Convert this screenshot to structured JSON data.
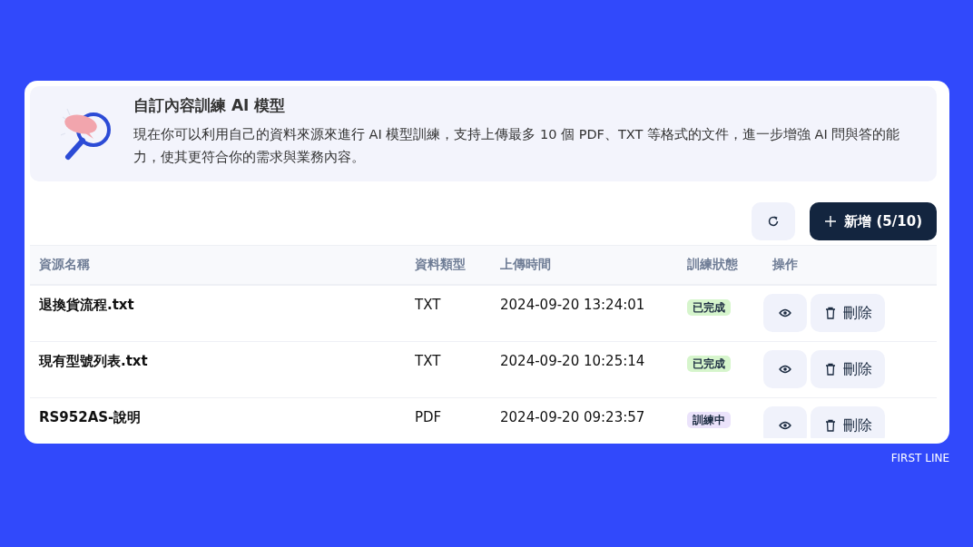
{
  "banner": {
    "title": "自訂內容訓練 AI 模型",
    "description": "現在你可以利用自己的資料來源來進行 AI 模型訓練，支持上傳最多 10 個 PDF、TXT 等格式的文件，進一步增強 AI 問與答的能力，使其更符合你的需求與業務內容。"
  },
  "toolbar": {
    "add_button": "新增 (5/10)"
  },
  "table": {
    "columns": [
      "資源名稱",
      "資料類型",
      "上傳時間",
      "訓練狀態",
      "操作"
    ],
    "rows": [
      {
        "name": "退換貨流程.txt",
        "type": "TXT",
        "uploaded": "2024-09-20 13:24:01",
        "status": {
          "label": "已完成",
          "kind": "done"
        },
        "delete": "刪除"
      },
      {
        "name": "現有型號列表.txt",
        "type": "TXT",
        "uploaded": "2024-09-20 10:25:14",
        "status": {
          "label": "已完成",
          "kind": "done"
        },
        "delete": "刪除"
      },
      {
        "name": "RS952AS-說明",
        "type": "PDF",
        "uploaded": "2024-09-20 09:23:57",
        "status": {
          "label": "訓練中",
          "kind": "training"
        },
        "delete": "刪除"
      }
    ]
  },
  "footer": "FIRST LINE"
}
